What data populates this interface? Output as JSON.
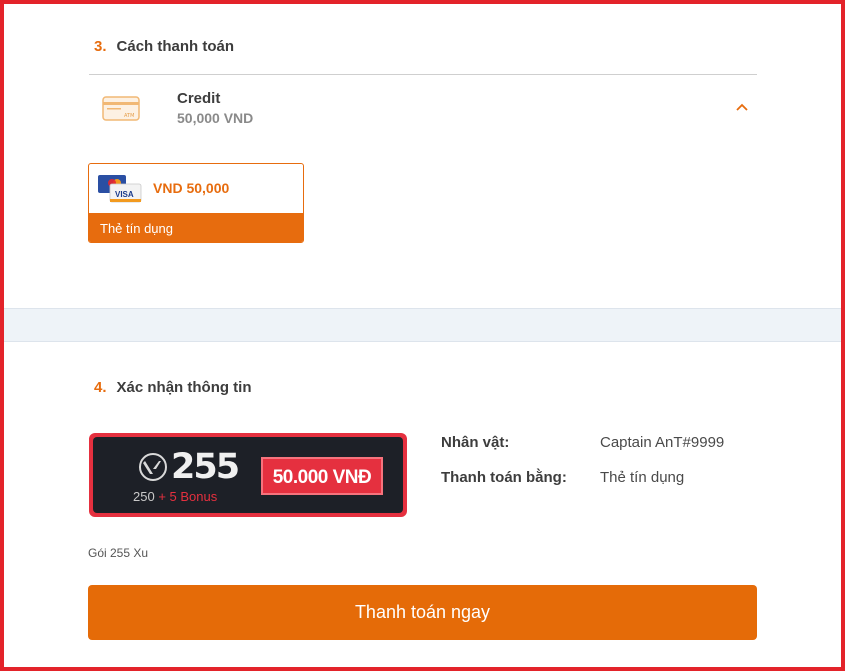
{
  "payment_section": {
    "number": "3.",
    "title": "Cách thanh toán",
    "method": {
      "name": "Credit",
      "price": "50,000 VND",
      "icon": "credit-card-icon",
      "icon_text": "ATM"
    },
    "option": {
      "price": "VND 50,000",
      "label": "Thẻ tín dụng",
      "icon": "mastercard-visa-icon",
      "icon_text": "VISA"
    }
  },
  "confirm_section": {
    "number": "4.",
    "title": "Xác nhận thông tin",
    "banner": {
      "points": "255",
      "base": "250",
      "bonus": "+ 5 Bonus",
      "price": "50.000 VNĐ"
    },
    "info": [
      {
        "label": "Nhân vật:",
        "value": "Captain AnT#9999"
      },
      {
        "label": "Thanh toán bằng:",
        "value": "Thẻ tín dụng"
      }
    ],
    "package_name": "Gói 255 Xu",
    "pay_button": "Thanh toán ngay"
  },
  "colors": {
    "accent": "#e76c0e",
    "frame": "#e3232a",
    "banner_red": "#e5303f",
    "banner_dark": "#1d2027"
  }
}
